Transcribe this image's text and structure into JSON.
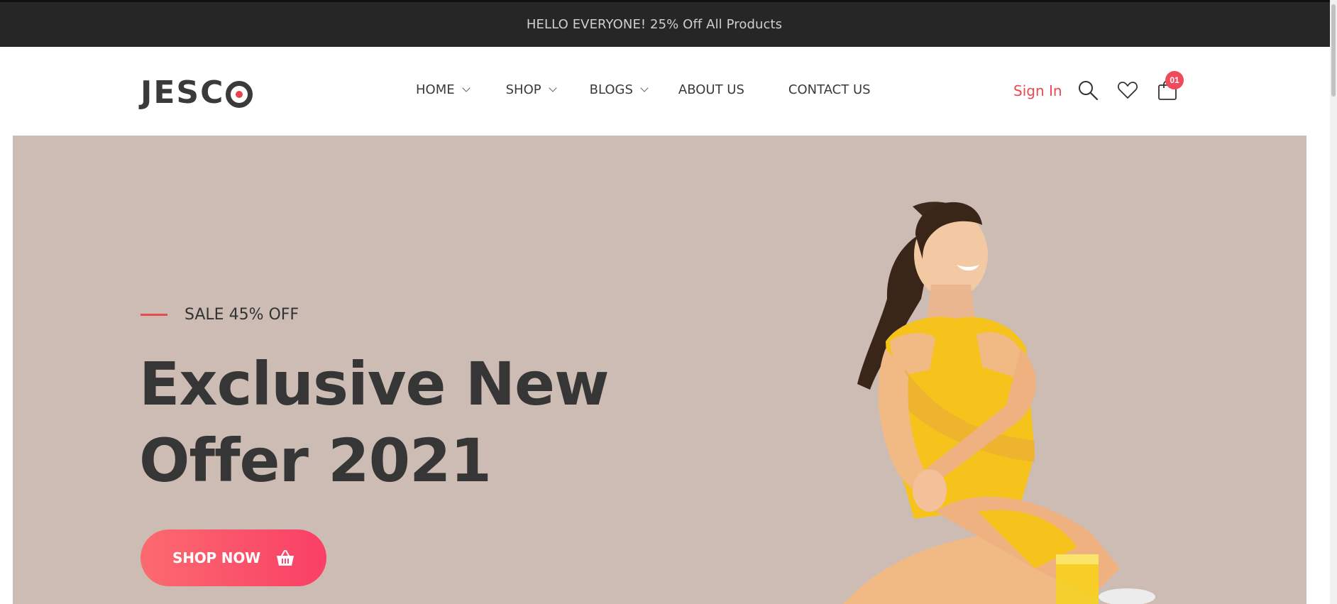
{
  "announcement": "HELLO EVERYONE! 25% Off All Products",
  "logo": {
    "text": "JESC"
  },
  "nav": [
    {
      "label": "HOME",
      "dropdown": true
    },
    {
      "label": "SHOP",
      "dropdown": true
    },
    {
      "label": "BLOGS",
      "dropdown": true
    },
    {
      "label": "ABOUT US",
      "dropdown": false
    },
    {
      "label": "CONTACT US",
      "dropdown": false
    }
  ],
  "header": {
    "signin": "Sign In",
    "cart_count": "01",
    "icons": [
      "search-icon",
      "heart-icon",
      "cart-icon"
    ]
  },
  "hero": {
    "tagline": "SALE 45% OFF",
    "headline_line1": "Exclusive New",
    "headline_line2": "Offer 2021",
    "button_label": "SHOP NOW",
    "button_icon": "basket-icon",
    "background": "#cdbcb4"
  },
  "colors": {
    "accent": "#e84a52",
    "dark": "#262626",
    "dress": "#f6c21c"
  }
}
